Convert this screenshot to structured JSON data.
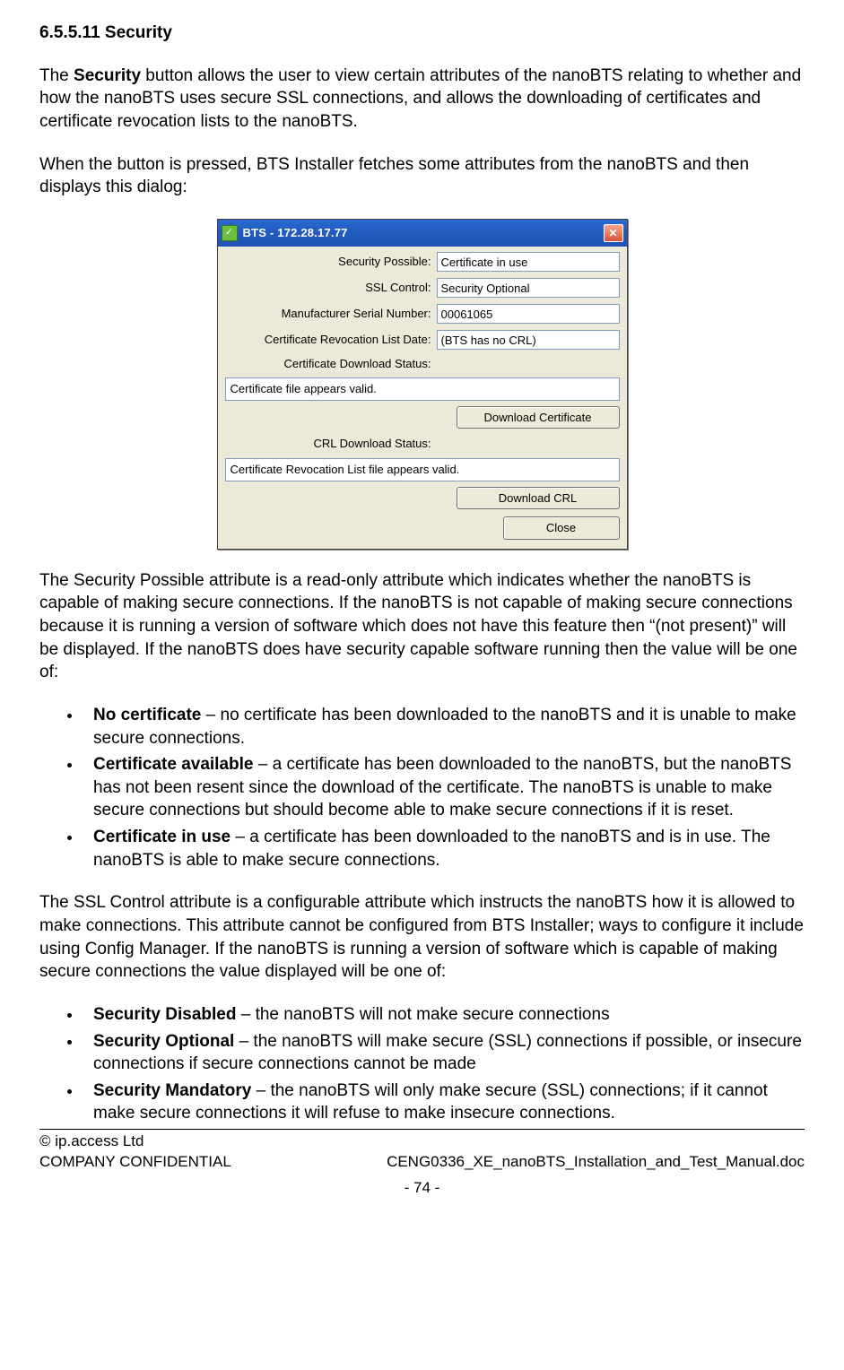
{
  "heading": "6.5.5.11 Security",
  "para1_a": "The ",
  "para1_bold": "Security",
  "para1_b": " button allows the user to view certain attributes of the nanoBTS relating to whether and how the nanoBTS uses secure SSL connections, and allows the downloading of certificates and certificate revocation lists to the nanoBTS.",
  "para2": "When the button is pressed, BTS Installer fetches some attributes from the nanoBTS and then displays this dialog:",
  "dialog": {
    "title": "BTS - 172.28.17.77",
    "labels": {
      "security_possible": "Security Possible:",
      "ssl_control": "SSL Control:",
      "serial": "Manufacturer Serial Number:",
      "crl_date": "Certificate Revocation List Date:",
      "cert_dl_status": "Certificate Download Status:",
      "crl_dl_status": "CRL Download Status:"
    },
    "values": {
      "security_possible": "Certificate in use",
      "ssl_control": "Security Optional",
      "serial": "00061065",
      "crl_date": "(BTS has no CRL)",
      "cert_status": "Certificate file appears valid.",
      "crl_status": "Certificate Revocation List file appears valid."
    },
    "buttons": {
      "download_cert": "Download Certificate",
      "download_crl": "Download CRL",
      "close": "Close"
    }
  },
  "para3": "The Security Possible attribute is a read-only attribute which indicates whether the nanoBTS is capable of making secure connections. If the nanoBTS is not capable of making secure connections because it is running a version of software which does not have this feature then “(not present)” will be displayed. If the nanoBTS does have security capable software running then the value will be one of:",
  "list1": {
    "i0_bold": "No certificate",
    "i0_rest": " – no certificate has been downloaded to the nanoBTS and it is unable to make secure connections.",
    "i1_bold": "Certificate available",
    "i1_rest": " – a certificate has been downloaded to the nanoBTS, but the nanoBTS has not been resent since the download of the certificate. The nanoBTS is unable to make secure connections but should become able to make secure connections if it is reset.",
    "i2_bold": "Certificate in use",
    "i2_rest": " – a certificate has been downloaded to the nanoBTS and is in use. The nanoBTS is able to make secure connections."
  },
  "para4": "The SSL Control attribute is a configurable attribute which instructs the nanoBTS how it is allowed to make connections. This attribute cannot be configured from BTS Installer; ways to configure it include using Config Manager. If the nanoBTS is running a version of software which is capable of making secure connections the value displayed will be one of:",
  "list2": {
    "i0_bold": "Security Disabled",
    "i0_rest": " – the nanoBTS will not make secure connections",
    "i1_bold": "Security Optional",
    "i1_rest": " – the nanoBTS will make secure (SSL) connections if possible, or insecure connections if secure connections cannot be made",
    "i2_bold": "Security Mandatory",
    "i2_rest": " – the nanoBTS will only make secure (SSL) connections; if it cannot make secure connections it will refuse to make insecure connections."
  },
  "footer": {
    "left1": "© ip.access Ltd",
    "left2": "COMPANY CONFIDENTIAL",
    "right": "CENG0336_XE_nanoBTS_Installation_and_Test_Manual.doc",
    "page": "- 74 -"
  }
}
